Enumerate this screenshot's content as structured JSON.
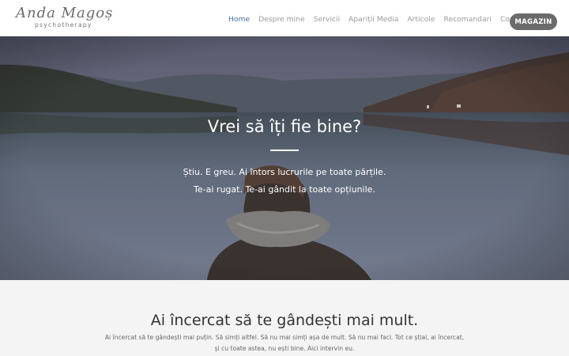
{
  "brand": {
    "script_name": "Anda Magoș",
    "tagline": "psychotherapy"
  },
  "nav": {
    "items": [
      {
        "label": "Home",
        "active": true
      },
      {
        "label": "Despre mine",
        "active": false
      },
      {
        "label": "Servicii",
        "active": false
      },
      {
        "label": "Apariții Media",
        "active": false
      },
      {
        "label": "Articole",
        "active": false
      },
      {
        "label": "Recomandari",
        "active": false
      },
      {
        "label": "Contact",
        "active": false
      }
    ],
    "shop_button": "MAGAZIN"
  },
  "hero": {
    "title": "Vrei să îți fie bine?",
    "line1": "Știu. E greu. Ai întors lucrurile pe toate părțile.",
    "line2": "Te-ai rugat. Te-ai gândit la toate opțiunile."
  },
  "intro": {
    "title": "Ai încercat să te gândești mai mult.",
    "text_line1": "Ai încercat să te gândești mai puțin. Să simți altfel. Să nu mai simți așa de mult. Să nu mai faci. Tot ce știai, ai încercat,",
    "text_line2": "și cu toate astea, nu ești bine. Aici intervin eu."
  },
  "colors": {
    "accent": "#4a6fa5",
    "shop_button_bg": "#6b6b6b",
    "nav_text": "#9a9a9a"
  }
}
